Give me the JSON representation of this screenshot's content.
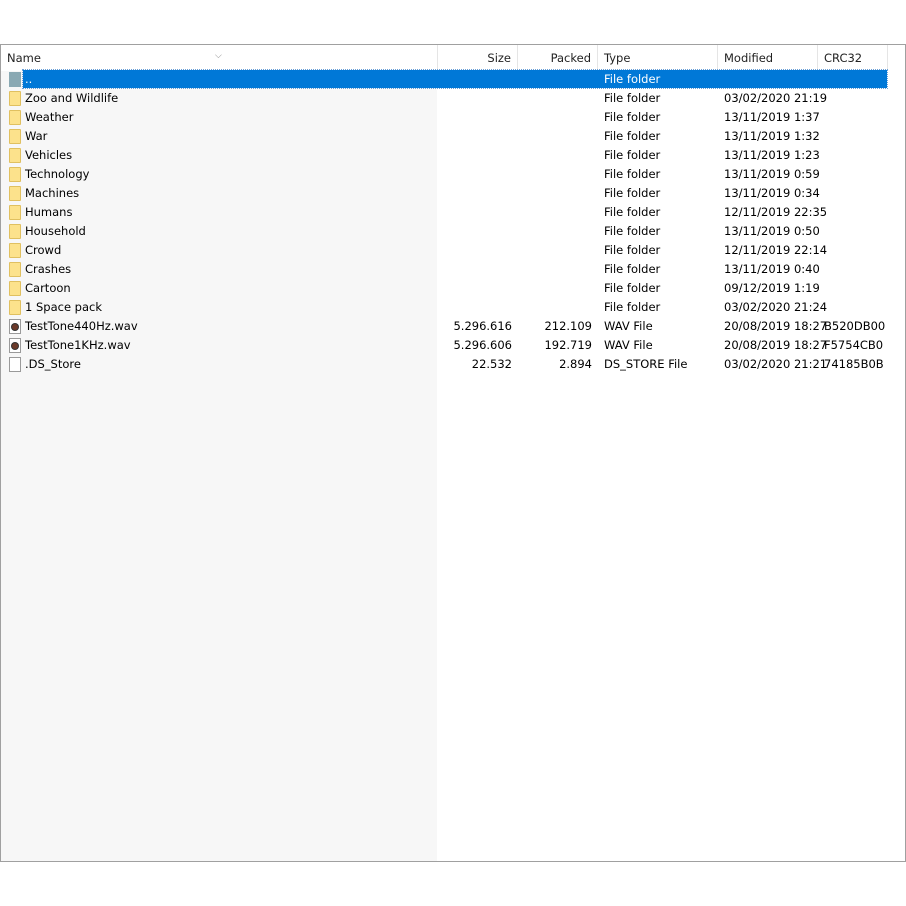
{
  "columns": [
    {
      "label": "Name"
    },
    {
      "label": "Size"
    },
    {
      "label": "Packed"
    },
    {
      "label": "Type"
    },
    {
      "label": "Modified"
    },
    {
      "label": "CRC32"
    }
  ],
  "sort_indicator": "chevron-down",
  "selection_color": "#0078d7",
  "rows": [
    {
      "name": "..",
      "size": "",
      "packed": "",
      "type": "File folder",
      "modified": "",
      "crc": "",
      "icon": "up",
      "selected": true
    },
    {
      "name": "Zoo and Wildlife",
      "size": "",
      "packed": "",
      "type": "File folder",
      "modified": "03/02/2020 21:19",
      "crc": "",
      "icon": "folder"
    },
    {
      "name": "Weather",
      "size": "",
      "packed": "",
      "type": "File folder",
      "modified": "13/11/2019 1:37",
      "crc": "",
      "icon": "folder"
    },
    {
      "name": "War",
      "size": "",
      "packed": "",
      "type": "File folder",
      "modified": "13/11/2019 1:32",
      "crc": "",
      "icon": "folder"
    },
    {
      "name": "Vehicles",
      "size": "",
      "packed": "",
      "type": "File folder",
      "modified": "13/11/2019 1:23",
      "crc": "",
      "icon": "folder"
    },
    {
      "name": "Technology",
      "size": "",
      "packed": "",
      "type": "File folder",
      "modified": "13/11/2019 0:59",
      "crc": "",
      "icon": "folder"
    },
    {
      "name": "Machines",
      "size": "",
      "packed": "",
      "type": "File folder",
      "modified": "13/11/2019 0:34",
      "crc": "",
      "icon": "folder"
    },
    {
      "name": "Humans",
      "size": "",
      "packed": "",
      "type": "File folder",
      "modified": "12/11/2019 22:35",
      "crc": "",
      "icon": "folder"
    },
    {
      "name": "Household",
      "size": "",
      "packed": "",
      "type": "File folder",
      "modified": "13/11/2019 0:50",
      "crc": "",
      "icon": "folder"
    },
    {
      "name": "Crowd",
      "size": "",
      "packed": "",
      "type": "File folder",
      "modified": "12/11/2019 22:14",
      "crc": "",
      "icon": "folder"
    },
    {
      "name": "Crashes",
      "size": "",
      "packed": "",
      "type": "File folder",
      "modified": "13/11/2019 0:40",
      "crc": "",
      "icon": "folder"
    },
    {
      "name": "Cartoon",
      "size": "",
      "packed": "",
      "type": "File folder",
      "modified": "09/12/2019 1:19",
      "crc": "",
      "icon": "folder"
    },
    {
      "name": "1 Space pack",
      "size": "",
      "packed": "",
      "type": "File folder",
      "modified": "03/02/2020 21:24",
      "crc": "",
      "icon": "folder"
    },
    {
      "name": "TestTone440Hz.wav",
      "size": "5.296.616",
      "packed": "212.109",
      "type": "WAV File",
      "modified": "20/08/2019 18:27",
      "crc": "B520DB00",
      "icon": "wav"
    },
    {
      "name": "TestTone1KHz.wav",
      "size": "5.296.606",
      "packed": "192.719",
      "type": "WAV File",
      "modified": "20/08/2019 18:27",
      "crc": "F5754CB0",
      "icon": "wav"
    },
    {
      "name": ".DS_Store",
      "size": "22.532",
      "packed": "2.894",
      "type": "DS_STORE File",
      "modified": "03/02/2020 21:21",
      "crc": "74185B0B",
      "icon": "file"
    }
  ]
}
